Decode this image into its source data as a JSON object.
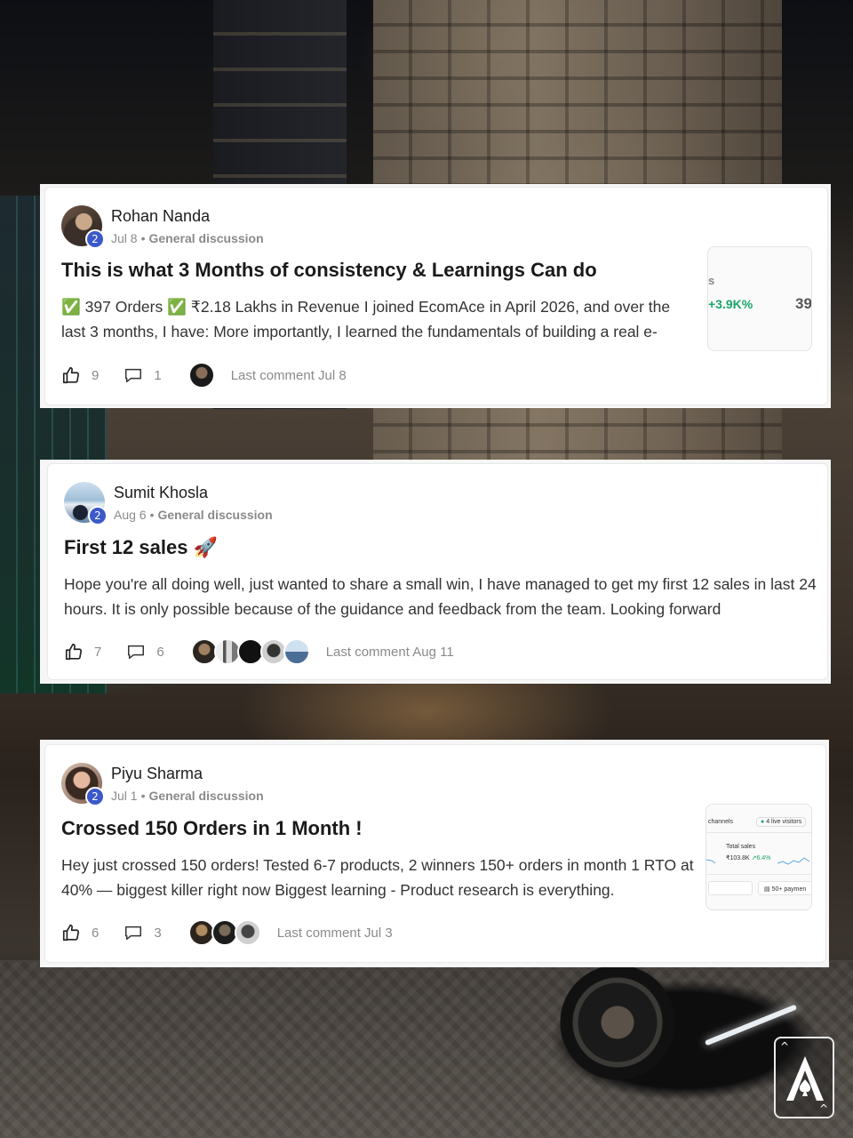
{
  "posts": [
    {
      "author": "Rohan Nanda",
      "level": "2",
      "date": "Jul 8",
      "separator": "•",
      "category": "General discussion",
      "title": "This is what 3 Months of consistency & Learnings Can do",
      "body": "✅ 397 Orders ✅ ₹2.18 Lakhs in Revenue I joined EcomAce in April 2026, and over the last 3 months, I have: More importantly, I learned the fundamentals of building a real e-",
      "likes": "9",
      "comments": "1",
      "last_comment": "Last comment Jul 8",
      "thumbnail": {
        "label": "s",
        "delta": "+3.9K%",
        "value": "39"
      }
    },
    {
      "author": "Sumit Khosla",
      "level": "2",
      "date": "Aug 6",
      "separator": "•",
      "category": "General discussion",
      "title": "First 12 sales 🚀",
      "body": "Hope you're all doing well, just wanted to share a small win, I have managed to get my first 12 sales in last 24 hours. It is only possible because of the guidance and feedback from the team. Looking forward",
      "likes": "7",
      "comments": "6",
      "last_comment": "Last comment Aug 11"
    },
    {
      "author": "Piyu Sharma",
      "level": "2",
      "date": "Jul 1",
      "separator": "•",
      "category": "General discussion",
      "title": "Crossed 150 Orders in 1 Month !",
      "body": "Hey just crossed 150 orders! Tested 6-7 products, 2 winners 150+ orders in month 1 RTO at 40% — biggest killer right now Biggest learning - Product research is everything.",
      "likes": "6",
      "comments": "3",
      "last_comment": "Last comment Jul 3",
      "thumbnail": {
        "channels": "channels",
        "live": "4 live visitors",
        "total_label": "Total sales",
        "total_value": "₹103.8K",
        "delta": "↗6.4%",
        "payments": "50+ paymen"
      }
    }
  ],
  "logo": {
    "corner_top": "^",
    "corner_bottom": "^"
  }
}
